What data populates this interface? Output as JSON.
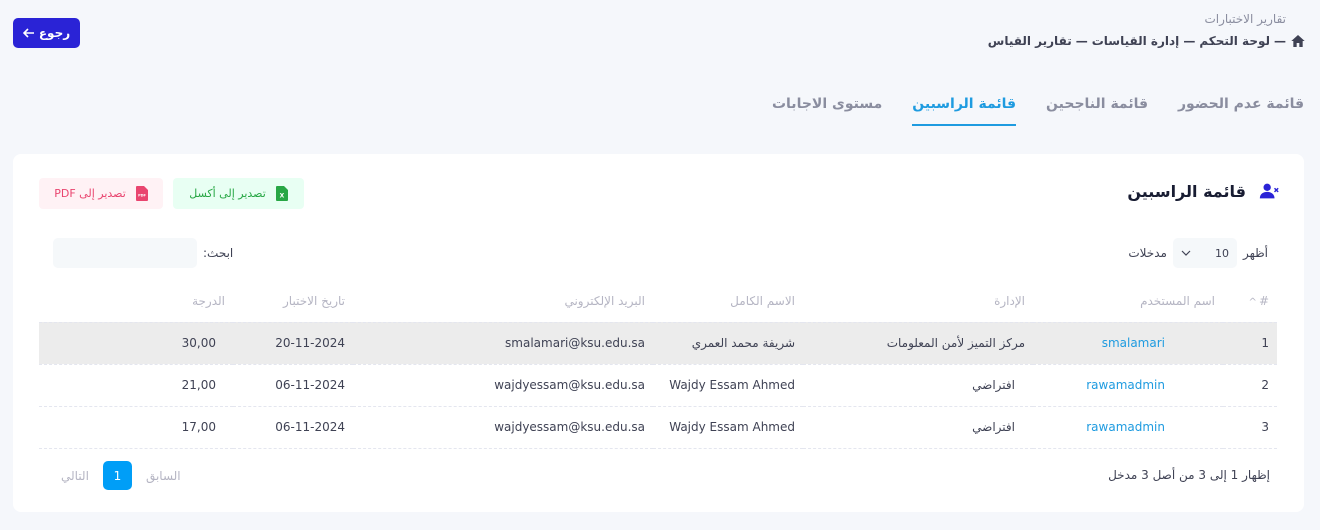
{
  "header": {
    "page_title": "تقارير الاختبارات",
    "breadcrumb": [
      "لوحة التحكم",
      "إدارة القياسات",
      "تقارير القياس"
    ],
    "separator": "—",
    "back_label": "رجوع"
  },
  "tabs": [
    {
      "label": "قائمة عدم الحضور",
      "active": false
    },
    {
      "label": "قائمة الناجحين",
      "active": false
    },
    {
      "label": "قائمة الراسبين",
      "active": true
    },
    {
      "label": "مستوى الاجابات",
      "active": false
    }
  ],
  "card": {
    "title": "قائمة الراسبين",
    "export_excel": "تصدير إلى أكسل",
    "export_pdf": "تصدير إلى PDF",
    "pdf_icon_text": "PDF",
    "excel_icon_text": "X",
    "length_prefix": "أظهر",
    "length_value": "10",
    "length_suffix": "مدخلات",
    "search_label": "ابحث:",
    "search_value": ""
  },
  "table": {
    "columns": [
      "#",
      "اسم المستخدم",
      "الإدارة",
      "الاسم الكامل",
      "البريد الإلكتروني",
      "تاريخ الاختبار",
      "الدرجة"
    ],
    "rows": [
      {
        "num": "1",
        "username": "smalamari",
        "dept": "مركز التميز لأمن المعلومات",
        "fullname": "شريفة محمد العمري",
        "email": "smalamari@ksu.edu.sa",
        "date": "20-11-2024",
        "score": "30,00"
      },
      {
        "num": "2",
        "username": "rawamadmin",
        "dept": "افتراضي",
        "fullname": "Wajdy Essam Ahmed",
        "email": "wajdyessam@ksu.edu.sa",
        "date": "06-11-2024",
        "score": "21,00"
      },
      {
        "num": "3",
        "username": "rawamadmin",
        "dept": "افتراضي",
        "fullname": "Wajdy Essam Ahmed",
        "email": "wajdyessam@ksu.edu.sa",
        "date": "06-11-2024",
        "score": "17,00"
      }
    ]
  },
  "footer": {
    "info": "إظهار 1 إلى 3 من أصل 3 مدخل",
    "prev": "السابق",
    "page": "1",
    "next": "التالي"
  },
  "colors": {
    "primary": "#2a23d6",
    "link": "#1e9be0",
    "excel": "#28a745",
    "pdf": "#e9456f",
    "page_active": "#009ef7"
  }
}
